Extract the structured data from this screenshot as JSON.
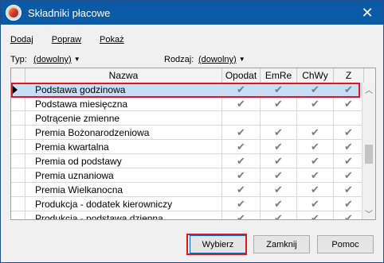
{
  "window": {
    "title": "Składniki płacowe"
  },
  "toolbar": {
    "items": [
      "Dodaj",
      "Popraw",
      "Pokaż"
    ]
  },
  "filters": {
    "type_label": "Typ:",
    "type_value": "(dowolny)",
    "kind_label": "Rodzaj:",
    "kind_value": "(dowolny)"
  },
  "grid": {
    "columns": [
      "Nazwa",
      "Opodat",
      "EmRe",
      "ChWy",
      "Z"
    ],
    "rows": [
      {
        "name": "Podstawa godzinowa",
        "flags": [
          "✔",
          "✔",
          "✔",
          "✔"
        ],
        "selected": true
      },
      {
        "name": "Podstawa miesięczna",
        "flags": [
          "✔",
          "✔",
          "✔",
          "✔"
        ]
      },
      {
        "name": "Potrącenie zmienne",
        "flags": [
          "",
          "",
          "",
          ""
        ]
      },
      {
        "name": "Premia Bożonarodzeniowa",
        "flags": [
          "✔",
          "✔",
          "✔",
          "✔"
        ]
      },
      {
        "name": "Premia kwartalna",
        "flags": [
          "✔",
          "✔",
          "✔",
          "✔"
        ]
      },
      {
        "name": "Premia od podstawy",
        "flags": [
          "✔",
          "✔",
          "✔",
          "✔"
        ]
      },
      {
        "name": "Premia uznaniowa",
        "flags": [
          "✔",
          "✔",
          "✔",
          "✔"
        ]
      },
      {
        "name": "Premia Wielkanocna",
        "flags": [
          "✔",
          "✔",
          "✔",
          "✔"
        ]
      },
      {
        "name": "Produkcja - dodatek kierowniczy",
        "flags": [
          "✔",
          "✔",
          "✔",
          "✔"
        ]
      },
      {
        "name": "Produkcja - podstawa dzienna",
        "flags": [
          "✔",
          "✔",
          "✔",
          "✔"
        ]
      }
    ]
  },
  "buttons": {
    "select": "Wybierz",
    "close": "Zamknij",
    "help": "Pomoc"
  },
  "icons": {
    "app": "app-logo-icon",
    "close": "close-icon",
    "caret": "chevron-down-icon",
    "check": "checkmark-icon"
  },
  "colors": {
    "titlebar": "#0b5aa8",
    "highlight": "#d71920",
    "selection": "#c9ddf5"
  }
}
